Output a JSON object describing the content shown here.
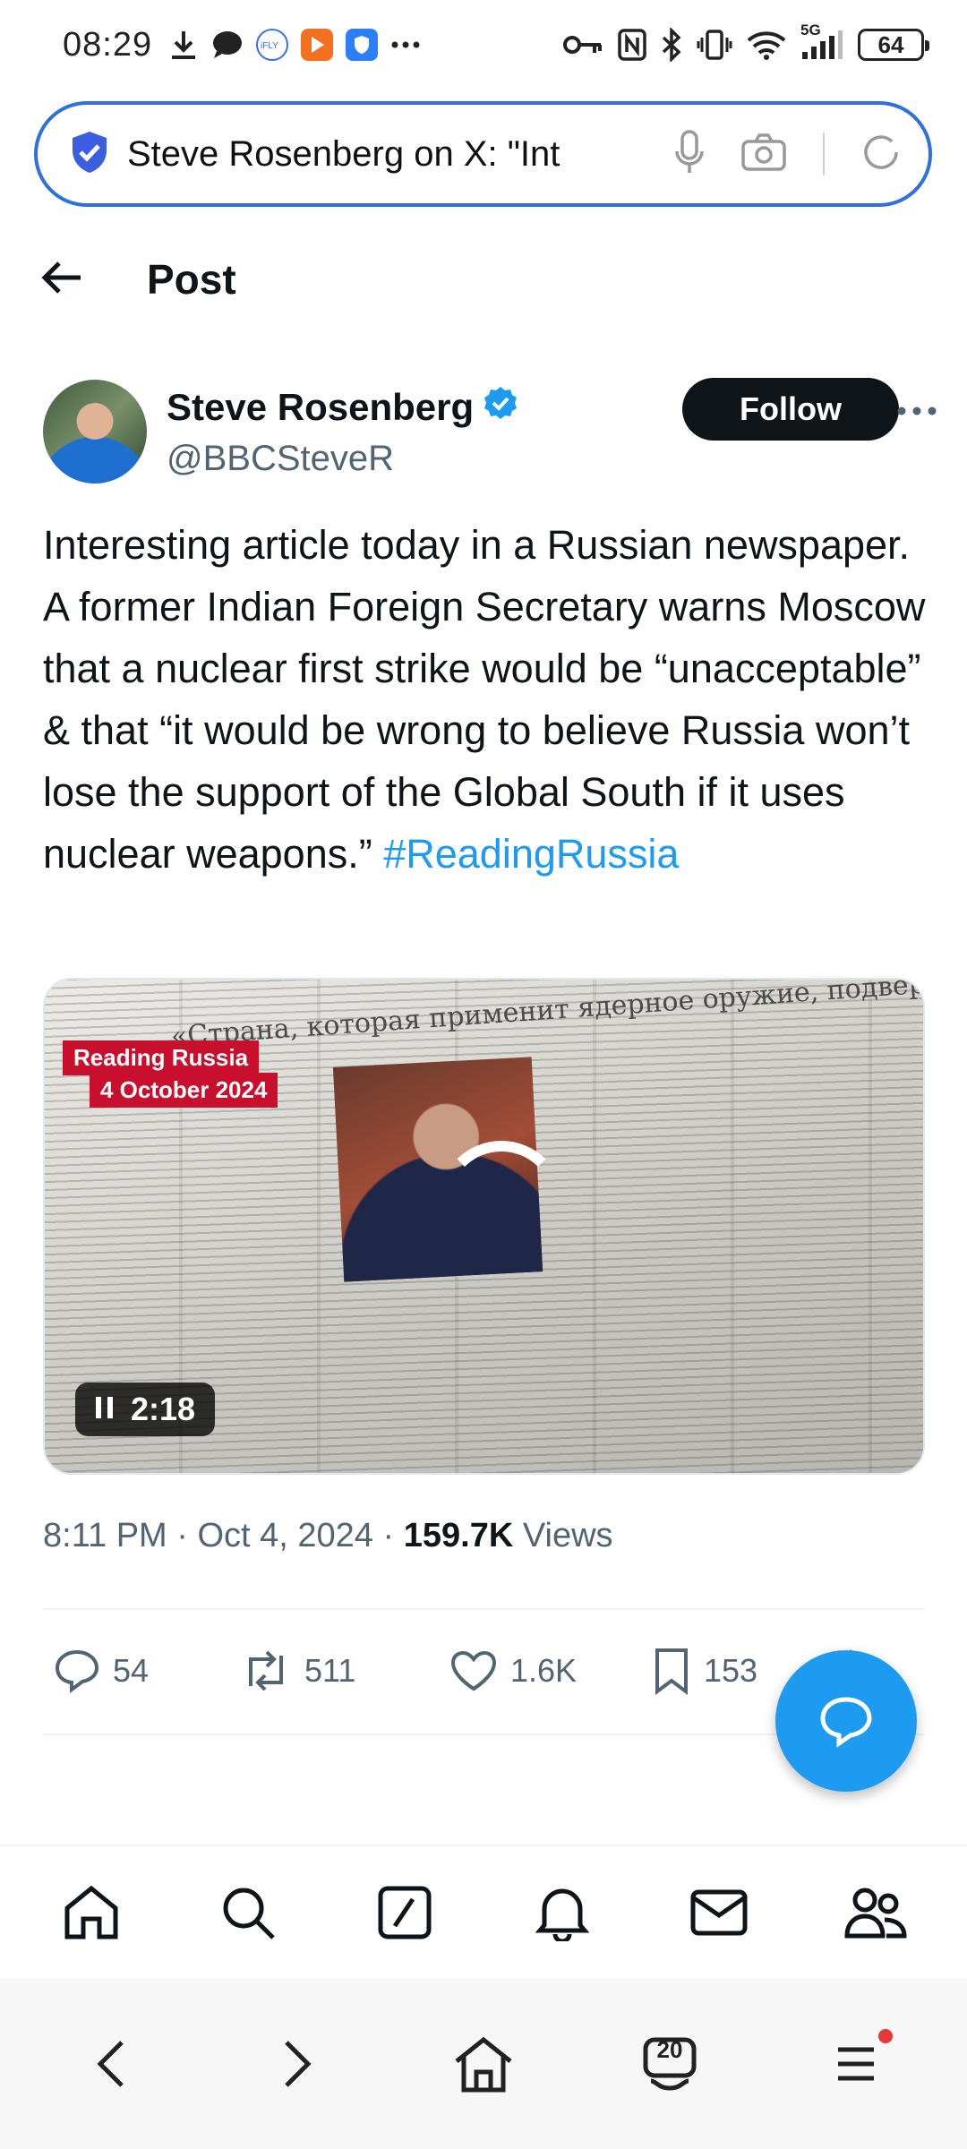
{
  "status_bar": {
    "time": "08:29",
    "network": "5G",
    "battery": "64"
  },
  "url_bar": {
    "text": "Steve Rosenberg on X: \"Int"
  },
  "header": {
    "title": "Post"
  },
  "author": {
    "name": "Steve Rosenberg",
    "handle": "@BBCSteveR",
    "follow_label": "Follow"
  },
  "tweet": {
    "text": "Interesting article today in a Russian newspaper. A former Indian Foreign Secretary warns Moscow that a nuclear first strike would be “unacceptable” & that “it would be wrong to believe Russia won’t lose the support of the Global South if it uses nuclear weapons.” ",
    "hashtag": "#ReadingRussia"
  },
  "media": {
    "label_line1": "Reading Russia",
    "label_line2": "4 October 2024",
    "headline": "«Страна, которая применит ядерное оружие, подвергнется остракизму»",
    "video_time": "2:18"
  },
  "meta": {
    "time": "8:11 PM",
    "date": "Oct 4, 2024",
    "views_count": "159.7K",
    "views_label": "Views"
  },
  "actions": {
    "replies": "54",
    "reposts": "511",
    "likes": "1.6K",
    "bookmarks": "153"
  },
  "browser": {
    "tab_count": "20"
  },
  "colors": {
    "accent": "#1d9bf0",
    "url_border": "#2f6fde",
    "verified": "#1d9bf0"
  }
}
